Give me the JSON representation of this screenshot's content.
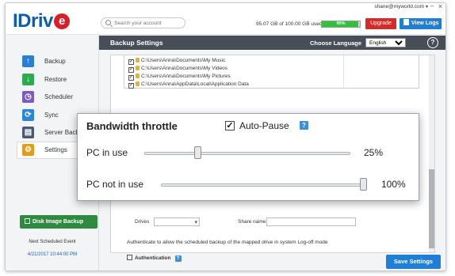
{
  "header": {
    "logo_text": "IDriv",
    "logo_e": "e",
    "search_placeholder": "Search your account",
    "user_email": "shane@myworld.com",
    "storage_text": "95.07 GB of 100.00 GB used",
    "storage_percent": 95,
    "storage_percent_label": "95%",
    "upgrade_label": "Upgrade",
    "view_logs_label": "View Logs",
    "minimize_glyph": "–",
    "close_glyph": "×"
  },
  "sidebar": {
    "items": [
      {
        "label": "Backup",
        "icon": "arrow-up-icon",
        "color": "#2a7fd1",
        "glyph": "↑"
      },
      {
        "label": "Restore",
        "icon": "arrow-down-icon",
        "color": "#2fa852",
        "glyph": "↓"
      },
      {
        "label": "Scheduler",
        "icon": "clock-icon",
        "color": "#7a5bc4",
        "glyph": "◷"
      },
      {
        "label": "Sync",
        "icon": "sync-icon",
        "color": "#2a86d6",
        "glyph": "⟳"
      },
      {
        "label": "Server Back",
        "icon": "server-icon",
        "color": "#4b5a72",
        "glyph": "▤"
      },
      {
        "label": "Settings",
        "icon": "gear-icon",
        "color": "#e39a1d",
        "glyph": "⚙"
      }
    ],
    "active_index": 5,
    "disk_image_label": "Disk Image Backup",
    "next_label": "Next Scheduled Event",
    "next_date": "4/21/2017 10:44:00 PM"
  },
  "main": {
    "title": "Backup Settings",
    "language_label": "Choose Language",
    "language_value": "English",
    "help_glyph": "?",
    "folders": [
      "C:\\Users\\Anna\\Documents\\My Music",
      "C:\\Users\\Anna\\Documents\\My Videos",
      "C:\\Users\\Anna\\Documents\\My Pictures",
      "C:\\Users\\Anna\\AppData\\Local\\Application Data"
    ],
    "check_glyph": "✓",
    "drives_label": "Drives",
    "share_label": "Share name",
    "auth_note": "Authenticate to allow the scheduled backup of the mapped drive in system Log-off mode",
    "auth_label": "Authentication",
    "auth_help": "?",
    "save_label": "Save Settings"
  },
  "popup": {
    "title": "Bandwidth throttle",
    "auto_pause_label": "Auto-Pause",
    "auto_pause_checked": true,
    "auto_pause_help": "?",
    "rows": [
      {
        "label": "PC in use",
        "value": "25%",
        "fraction": 0.25
      },
      {
        "label": "PC not in use",
        "value": "100%",
        "fraction": 1.0
      }
    ]
  }
}
